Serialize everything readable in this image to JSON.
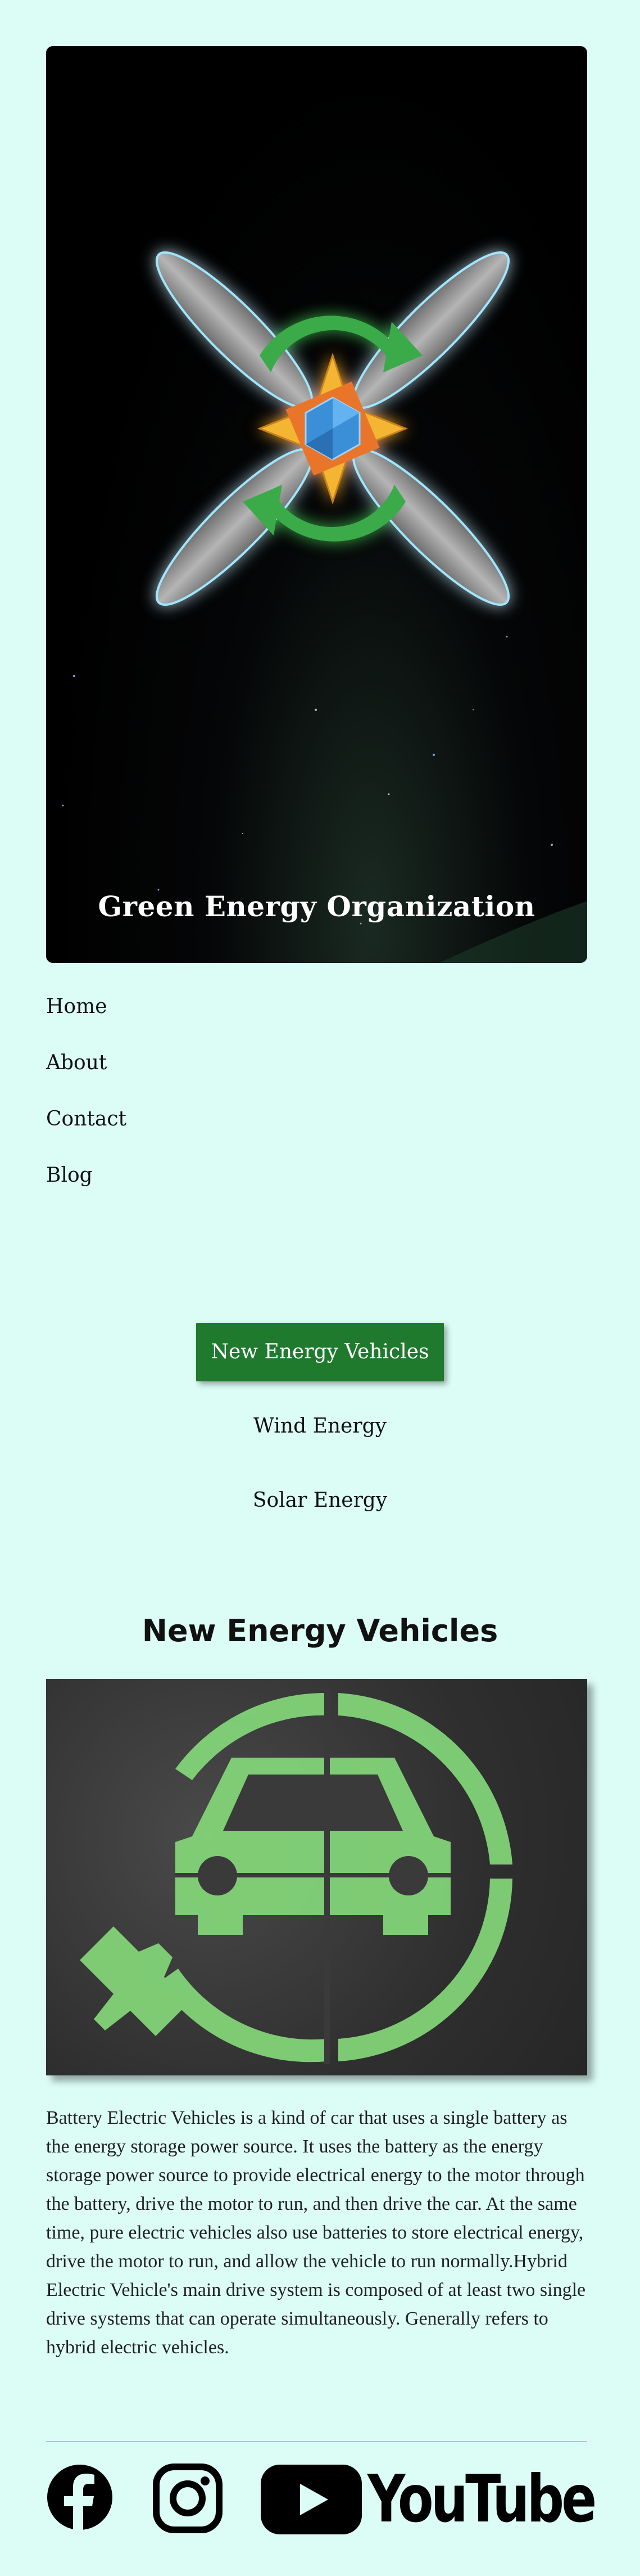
{
  "header": {
    "title": "Green Energy Organization",
    "logo_icon": "green-energy-logo-icon"
  },
  "nav": {
    "items": [
      {
        "label": "Home"
      },
      {
        "label": "About"
      },
      {
        "label": "Contact"
      },
      {
        "label": "Blog"
      }
    ]
  },
  "tabs": {
    "items": [
      {
        "label": "New Energy Vehicles",
        "active": true
      },
      {
        "label": "Wind Energy",
        "active": false
      },
      {
        "label": "Solar Energy",
        "active": false
      }
    ]
  },
  "content": {
    "title": "New Energy Vehicles",
    "image_icon": "electric-car-charging-icon",
    "body": "Battery Electric Vehicles is a kind of car that uses a single battery as the energy storage power source. It uses the battery as the energy storage power source to provide electrical energy to the motor through the battery, drive the motor to run, and then drive the car. At the same time, pure electric vehicles also use batteries to store electrical energy, drive the motor to run, and allow the vehicle to run normally.Hybrid Electric Vehicle's main drive system is composed of at least two single drive systems that can operate simultaneously. Generally refers to hybrid electric vehicles."
  },
  "footer": {
    "social": [
      {
        "icon": "facebook-icon"
      },
      {
        "icon": "instagram-icon"
      },
      {
        "icon": "youtube-icon",
        "label": "YouTube"
      }
    ]
  },
  "colors": {
    "page_bg": "#dcfcf6",
    "accent": "#1f7a2e",
    "divider": "#8fd6d2"
  }
}
